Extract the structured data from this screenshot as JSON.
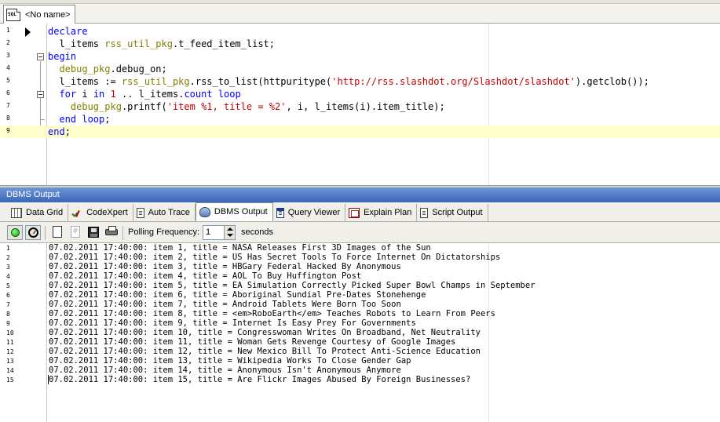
{
  "document_tab": {
    "icon_text": "SQL",
    "label": "<No name>"
  },
  "editor": {
    "lines": [
      {
        "num": "1",
        "tokens": [
          {
            "t": "declare",
            "c": "kw"
          }
        ]
      },
      {
        "num": "2",
        "tokens": [
          {
            "t": "  l_items ",
            "c": "plain"
          },
          {
            "t": "rss_util_pkg",
            "c": "pkg"
          },
          {
            "t": ".t_feed_item_list;",
            "c": "plain"
          }
        ]
      },
      {
        "num": "3",
        "tokens": [
          {
            "t": "begin",
            "c": "kw"
          }
        ]
      },
      {
        "num": "4",
        "tokens": [
          {
            "t": "  ",
            "c": "plain"
          },
          {
            "t": "debug_pkg",
            "c": "pkg"
          },
          {
            "t": ".debug_on;",
            "c": "plain"
          }
        ]
      },
      {
        "num": "5",
        "tokens": [
          {
            "t": "  l_items := ",
            "c": "plain"
          },
          {
            "t": "rss_util_pkg",
            "c": "pkg"
          },
          {
            "t": ".rss_to_list(httpuritype(",
            "c": "plain"
          },
          {
            "t": "'http://rss.slashdot.org/Slashdot/slashdot'",
            "c": "str"
          },
          {
            "t": ").getclob());",
            "c": "plain"
          }
        ]
      },
      {
        "num": "6",
        "tokens": [
          {
            "t": "  ",
            "c": "plain"
          },
          {
            "t": "for",
            "c": "kw"
          },
          {
            "t": " i ",
            "c": "plain"
          },
          {
            "t": "in",
            "c": "kw"
          },
          {
            "t": " ",
            "c": "plain"
          },
          {
            "t": "1",
            "c": "str"
          },
          {
            "t": " .. l_items.",
            "c": "plain"
          },
          {
            "t": "count",
            "c": "kw"
          },
          {
            "t": " ",
            "c": "plain"
          },
          {
            "t": "loop",
            "c": "kw"
          }
        ]
      },
      {
        "num": "7",
        "tokens": [
          {
            "t": "    ",
            "c": "plain"
          },
          {
            "t": "debug_pkg",
            "c": "pkg"
          },
          {
            "t": ".printf(",
            "c": "plain"
          },
          {
            "t": "'item %1, title = %2'",
            "c": "str"
          },
          {
            "t": ", i, l_items(i).item_title);",
            "c": "plain"
          }
        ]
      },
      {
        "num": "8",
        "tokens": [
          {
            "t": "  ",
            "c": "plain"
          },
          {
            "t": "end loop",
            "c": "kw"
          },
          {
            "t": ";",
            "c": "plain"
          }
        ]
      },
      {
        "num": "9",
        "tokens": [
          {
            "t": "end",
            "c": "kw"
          },
          {
            "t": ";",
            "c": "plain"
          }
        ]
      }
    ]
  },
  "panel": {
    "title": "DBMS Output"
  },
  "output_tabs": [
    {
      "label": "Data Grid",
      "icon": "grid-icon",
      "active": false
    },
    {
      "label": "CodeXpert",
      "icon": "codexpert-icon",
      "active": false
    },
    {
      "label": "Auto Trace",
      "icon": "page-icon",
      "active": false
    },
    {
      "label": "DBMS Output",
      "icon": "dbms-icon",
      "active": true
    },
    {
      "label": "Query Viewer",
      "icon": "page-icon",
      "active": false
    },
    {
      "label": "Explain Plan",
      "icon": "plan-icon",
      "active": false
    },
    {
      "label": "Script Output",
      "icon": "page-icon",
      "active": false
    }
  ],
  "toolbar": {
    "polling_label": "Polling Frequency:",
    "polling_value": "1",
    "polling_unit": "seconds"
  },
  "output": {
    "lines": [
      {
        "num": "1",
        "text": "07.02.2011 17:40:00: item 1, title = NASA Releases First 3D Images of the Sun"
      },
      {
        "num": "2",
        "text": "07.02.2011 17:40:00: item 2, title = US Has Secret Tools To Force Internet On Dictatorships"
      },
      {
        "num": "3",
        "text": "07.02.2011 17:40:00: item 3, title = HBGary Federal Hacked By Anonymous"
      },
      {
        "num": "4",
        "text": "07.02.2011 17:40:00: item 4, title = AOL To Buy Huffington Post"
      },
      {
        "num": "5",
        "text": "07.02.2011 17:40:00: item 5, title = EA Simulation Correctly Picked Super Bowl Champs in September"
      },
      {
        "num": "6",
        "text": "07.02.2011 17:40:00: item 6, title = Aboriginal Sundial Pre-Dates Stonehenge"
      },
      {
        "num": "7",
        "text": "07.02.2011 17:40:00: item 7, title = Android Tablets Were Born Too Soon"
      },
      {
        "num": "8",
        "text": "07.02.2011 17:40:00: item 8, title = <em>RoboEarth</em> Teaches Robots to Learn From Peers"
      },
      {
        "num": "9",
        "text": "07.02.2011 17:40:00: item 9, title = Internet Is Easy Prey For Governments"
      },
      {
        "num": "10",
        "text": "07.02.2011 17:40:00: item 10, title = Congresswoman Writes On Broadband, Net Neutrality"
      },
      {
        "num": "11",
        "text": "07.02.2011 17:40:00: item 11, title = Woman Gets Revenge Courtesy of Google Images"
      },
      {
        "num": "12",
        "text": "07.02.2011 17:40:00: item 12, title = New Mexico Bill To Protect Anti-Science Education"
      },
      {
        "num": "13",
        "text": "07.02.2011 17:40:00: item 13, title = Wikipedia Works To Close Gender Gap"
      },
      {
        "num": "14",
        "text": "07.02.2011 17:40:00: item 14, title = Anonymous Isn't Anonymous Anymore"
      },
      {
        "num": "15",
        "text": "07.02.2011 17:40:00: item 15, title = Are Flickr Images Abused By Foreign Businesses?"
      }
    ]
  },
  "colors": {
    "keyword": "#0000ff",
    "package": "#808000",
    "string": "#c00000",
    "current_line": "#ffffcc",
    "panel_title": "#3a66b8"
  }
}
